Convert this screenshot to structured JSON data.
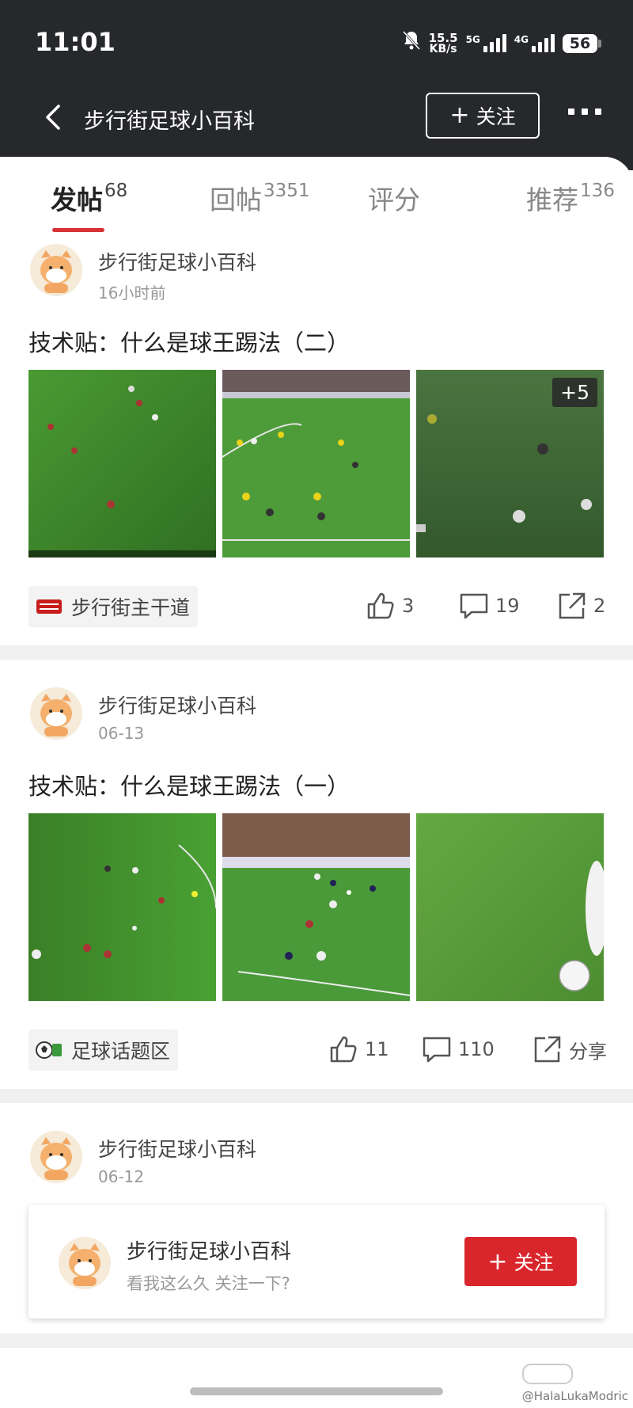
{
  "status_bar": {
    "time": "11:01",
    "net_speed": "15.5",
    "net_speed_unit": "KB/s",
    "signal1": "5G",
    "signal2": "4G",
    "battery": "56"
  },
  "nav": {
    "title": "步行街足球小百科",
    "follow_label": "关注"
  },
  "tabs": [
    {
      "label": "发帖",
      "count": "68",
      "active": true
    },
    {
      "label": "回帖",
      "count": "3351",
      "active": false
    },
    {
      "label": "评分",
      "count": "",
      "active": false
    },
    {
      "label": "推荐",
      "count": "136",
      "active": false
    }
  ],
  "posts": [
    {
      "author": "步行街足球小百科",
      "time": "16小时前",
      "title": "技术贴：什么是球王踢法（二）",
      "more_images": "+5",
      "board": "步行街主干道",
      "likes": "3",
      "comments": "19",
      "shares": "2"
    },
    {
      "author": "步行街足球小百科",
      "time": "06-13",
      "title": "技术贴：什么是球王踢法（一）",
      "board": "足球话题区",
      "likes": "11",
      "comments": "110",
      "shares": "分享"
    },
    {
      "author": "步行街足球小百科",
      "time": "06-12"
    }
  ],
  "follow_card": {
    "name": "步行街足球小百科",
    "subtitle": "看我这么久 关注一下?",
    "button_label": "关注"
  },
  "watermark": "@HalaLukaModric",
  "colors": {
    "header_bg": "#26282c",
    "accent_red": "#d9262c",
    "pitch_green": "#3f8a2c"
  }
}
